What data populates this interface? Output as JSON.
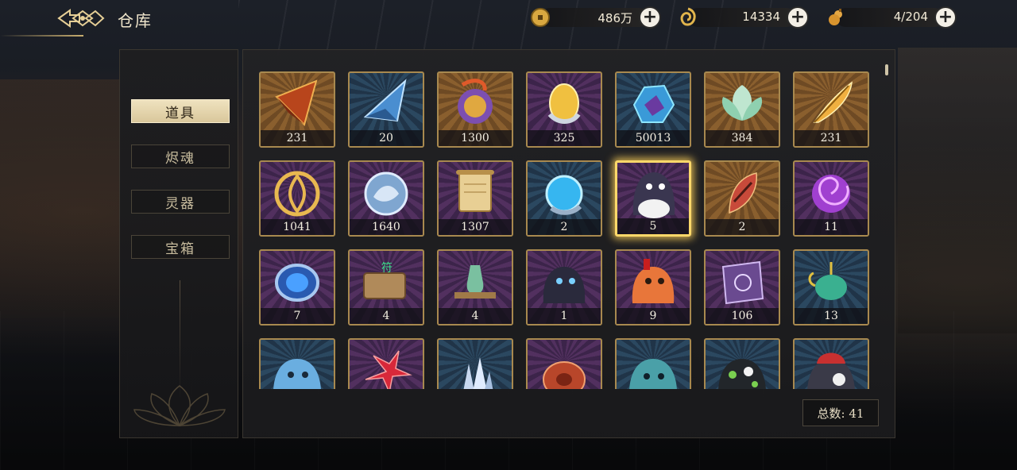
{
  "header": {
    "title": "仓库"
  },
  "currencies": [
    {
      "icon": "coin-icon",
      "value": "486万"
    },
    {
      "icon": "jade-icon",
      "value": "14334"
    },
    {
      "icon": "stamina-gourd-icon",
      "value": "4/204"
    }
  ],
  "categories": [
    {
      "label": "道具",
      "active": true
    },
    {
      "label": "烬魂",
      "active": false
    },
    {
      "label": "灵器",
      "active": false
    },
    {
      "label": "宝箱",
      "active": false
    }
  ],
  "items": [
    {
      "name": "red-crystal-icon",
      "rarity": "gold",
      "count": "231"
    },
    {
      "name": "blue-crystal-icon",
      "rarity": "blue",
      "count": "20"
    },
    {
      "name": "dragon-orb-icon",
      "rarity": "gold",
      "count": "1300"
    },
    {
      "name": "golden-egg-icon",
      "rarity": "purple",
      "count": "325"
    },
    {
      "name": "blue-ore-icon",
      "rarity": "blue",
      "count": "50013"
    },
    {
      "name": "lotus-icon",
      "rarity": "gold",
      "count": "384"
    },
    {
      "name": "golden-feather-icon",
      "rarity": "gold",
      "count": "231"
    },
    {
      "name": "gold-knot-icon",
      "rarity": "purple",
      "count": "1041"
    },
    {
      "name": "silver-medallion-icon",
      "rarity": "purple",
      "count": "1640"
    },
    {
      "name": "scroll-icon",
      "rarity": "purple",
      "count": "1307"
    },
    {
      "name": "water-orb-icon",
      "rarity": "blue",
      "count": "2"
    },
    {
      "name": "dark-blob-icon",
      "rarity": "purple",
      "count": "5",
      "selected": true
    },
    {
      "name": "red-feather-icon",
      "rarity": "gold",
      "count": "2"
    },
    {
      "name": "purple-vortex-icon",
      "rarity": "purple",
      "count": "11"
    },
    {
      "name": "blue-jewel-icon",
      "rarity": "purple",
      "count": "7"
    },
    {
      "name": "stone-tablet-icon",
      "rarity": "purple",
      "count": "4"
    },
    {
      "name": "tea-set-icon",
      "rarity": "purple",
      "count": "4"
    },
    {
      "name": "spirit-blob-dark-icon",
      "rarity": "purple",
      "count": "1"
    },
    {
      "name": "spirit-blob-orange-icon",
      "rarity": "purple",
      "count": "9"
    },
    {
      "name": "purple-cloth-icon",
      "rarity": "purple",
      "count": "106"
    },
    {
      "name": "jade-teapot-icon",
      "rarity": "blue",
      "count": "13"
    },
    {
      "name": "spirit-blob-blue-icon",
      "rarity": "blue",
      "count": ""
    },
    {
      "name": "red-flower-icon",
      "rarity": "purple",
      "count": ""
    },
    {
      "name": "crystal-cluster-icon",
      "rarity": "blue",
      "count": ""
    },
    {
      "name": "red-shell-icon",
      "rarity": "purple",
      "count": ""
    },
    {
      "name": "spirit-blob-teal-icon",
      "rarity": "blue",
      "count": ""
    },
    {
      "name": "spirit-blob-spotted-icon",
      "rarity": "blue",
      "count": ""
    },
    {
      "name": "spirit-blob-red-hat-icon",
      "rarity": "blue",
      "count": ""
    }
  ],
  "total": {
    "text": "总数: 41"
  },
  "colors": {
    "accent": "#ffd86a",
    "frame": "#a8894f",
    "panel": "#222224"
  }
}
